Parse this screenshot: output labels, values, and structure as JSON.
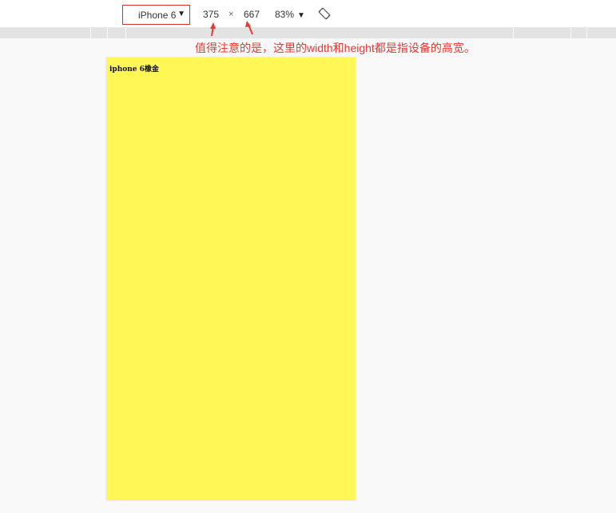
{
  "toolbar": {
    "device": "iPhone 6",
    "width": "375",
    "times": "×",
    "height": "667",
    "zoom": "83%",
    "dropdown_icon": "caret-down-icon",
    "rotate_icon": "rotate-icon"
  },
  "annotation": {
    "text": "值得注意的是，这里的width和height都是指设备的高宽。",
    "color": "#e53935"
  },
  "viewport": {
    "text": "iphone 6橡金",
    "background": "#fff756"
  },
  "colors": {
    "highlight_border": "#d93025",
    "ruler": "#e3e3e3"
  }
}
